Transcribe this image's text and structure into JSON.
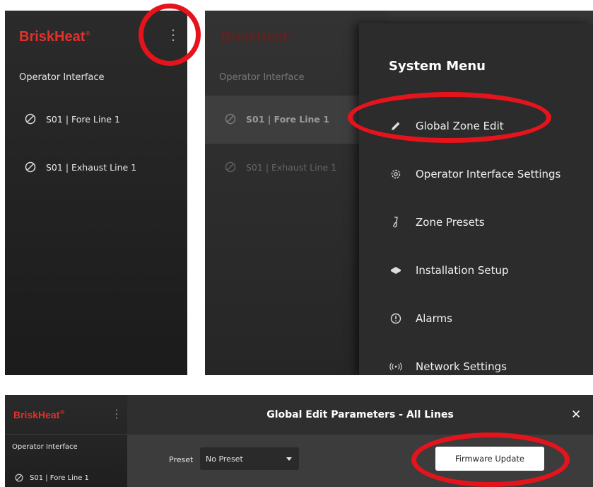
{
  "panel_a": {
    "brand": "BriskHeat",
    "trademark": "®",
    "subtitle": "Operator Interface",
    "items": [
      {
        "label": "S01 | Fore Line 1"
      },
      {
        "label": "S01 | Exhaust Line 1"
      }
    ]
  },
  "panel_b": {
    "brand": "BriskHeat",
    "trademark": "®",
    "subtitle": "Operator Interface",
    "items": [
      {
        "label": "S01 | Fore Line 1"
      },
      {
        "label": "S01 | Exhaust Line 1"
      }
    ],
    "menu": {
      "title": "System Menu",
      "items": [
        {
          "label": "Global Zone Edit",
          "icon": "pencil-icon"
        },
        {
          "label": "Operator Interface Settings",
          "icon": "gear-icon"
        },
        {
          "label": "Zone Presets",
          "icon": "zone-presets-icon"
        },
        {
          "label": "Installation Setup",
          "icon": "installation-icon"
        },
        {
          "label": "Alarms",
          "icon": "alert-circle-icon"
        },
        {
          "label": "Network Settings",
          "icon": "broadcast-icon"
        }
      ]
    }
  },
  "panel_c": {
    "brand": "BriskHeat",
    "trademark": "®",
    "subtitle": "Operator Interface",
    "items": [
      {
        "label": "S01 | Fore Line 1"
      }
    ],
    "header_title": "Global Edit Parameters - All Lines",
    "close_label": "✕",
    "preset_label": "Preset",
    "preset_value": "No Preset",
    "firmware_button": "Firmware Update"
  },
  "colors": {
    "brand_red": "#e0322d",
    "panel_bg": "#262626",
    "highlight_red": "#e5141c"
  }
}
